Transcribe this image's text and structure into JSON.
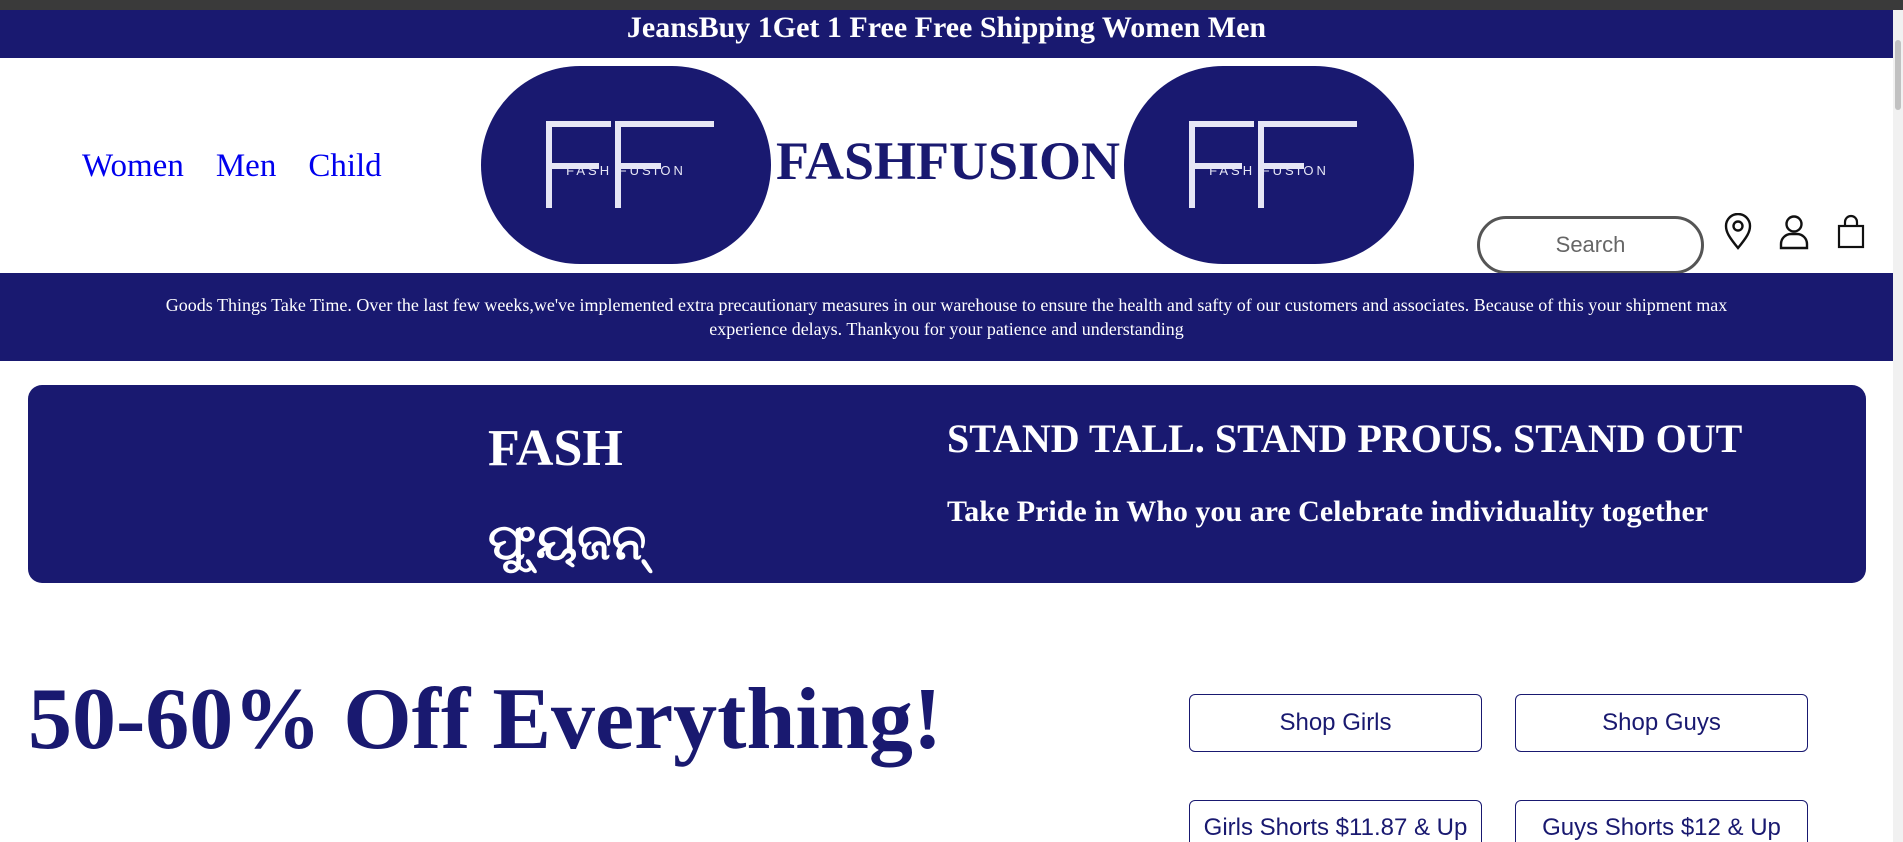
{
  "promo": {
    "text": "JeansBuy 1Get 1 Free Free Shipping Women Men"
  },
  "nav": {
    "items": [
      "Women",
      "Men",
      "Child"
    ]
  },
  "logo": {
    "monogram": "FF",
    "text": "FASH FUSION"
  },
  "brand": {
    "title": "FASHFUSION"
  },
  "search": {
    "placeholder": "Search"
  },
  "icons": {
    "location": "location-pin-icon",
    "account": "user-icon",
    "cart": "shopping-bag-icon"
  },
  "notice": {
    "text": "Goods Things Take Time. Over the last few weeks,we've implemented extra precautionary measures in our warehouse to ensure the health and safty of our customers and associates. Because of this your shipment max experience delays. Thankyou for your patience and understanding"
  },
  "hero": {
    "fash": "FASH",
    "script": "ଫ୍ୟୁଜନ୍",
    "headline": "STAND TALL. STAND PROUS. STAND OUT",
    "subline": "Take Pride in Who you are Celebrate individuality together"
  },
  "sale": {
    "title": "50-60% Off Everything!"
  },
  "shop_buttons": [
    "Shop Girls",
    "Shop Guys",
    "Girls Shorts $11.87 & Up",
    "Guys Shorts $12 & Up"
  ],
  "colors": {
    "navy": "#191970",
    "link": "#0000ee",
    "white": "#ffffff"
  }
}
